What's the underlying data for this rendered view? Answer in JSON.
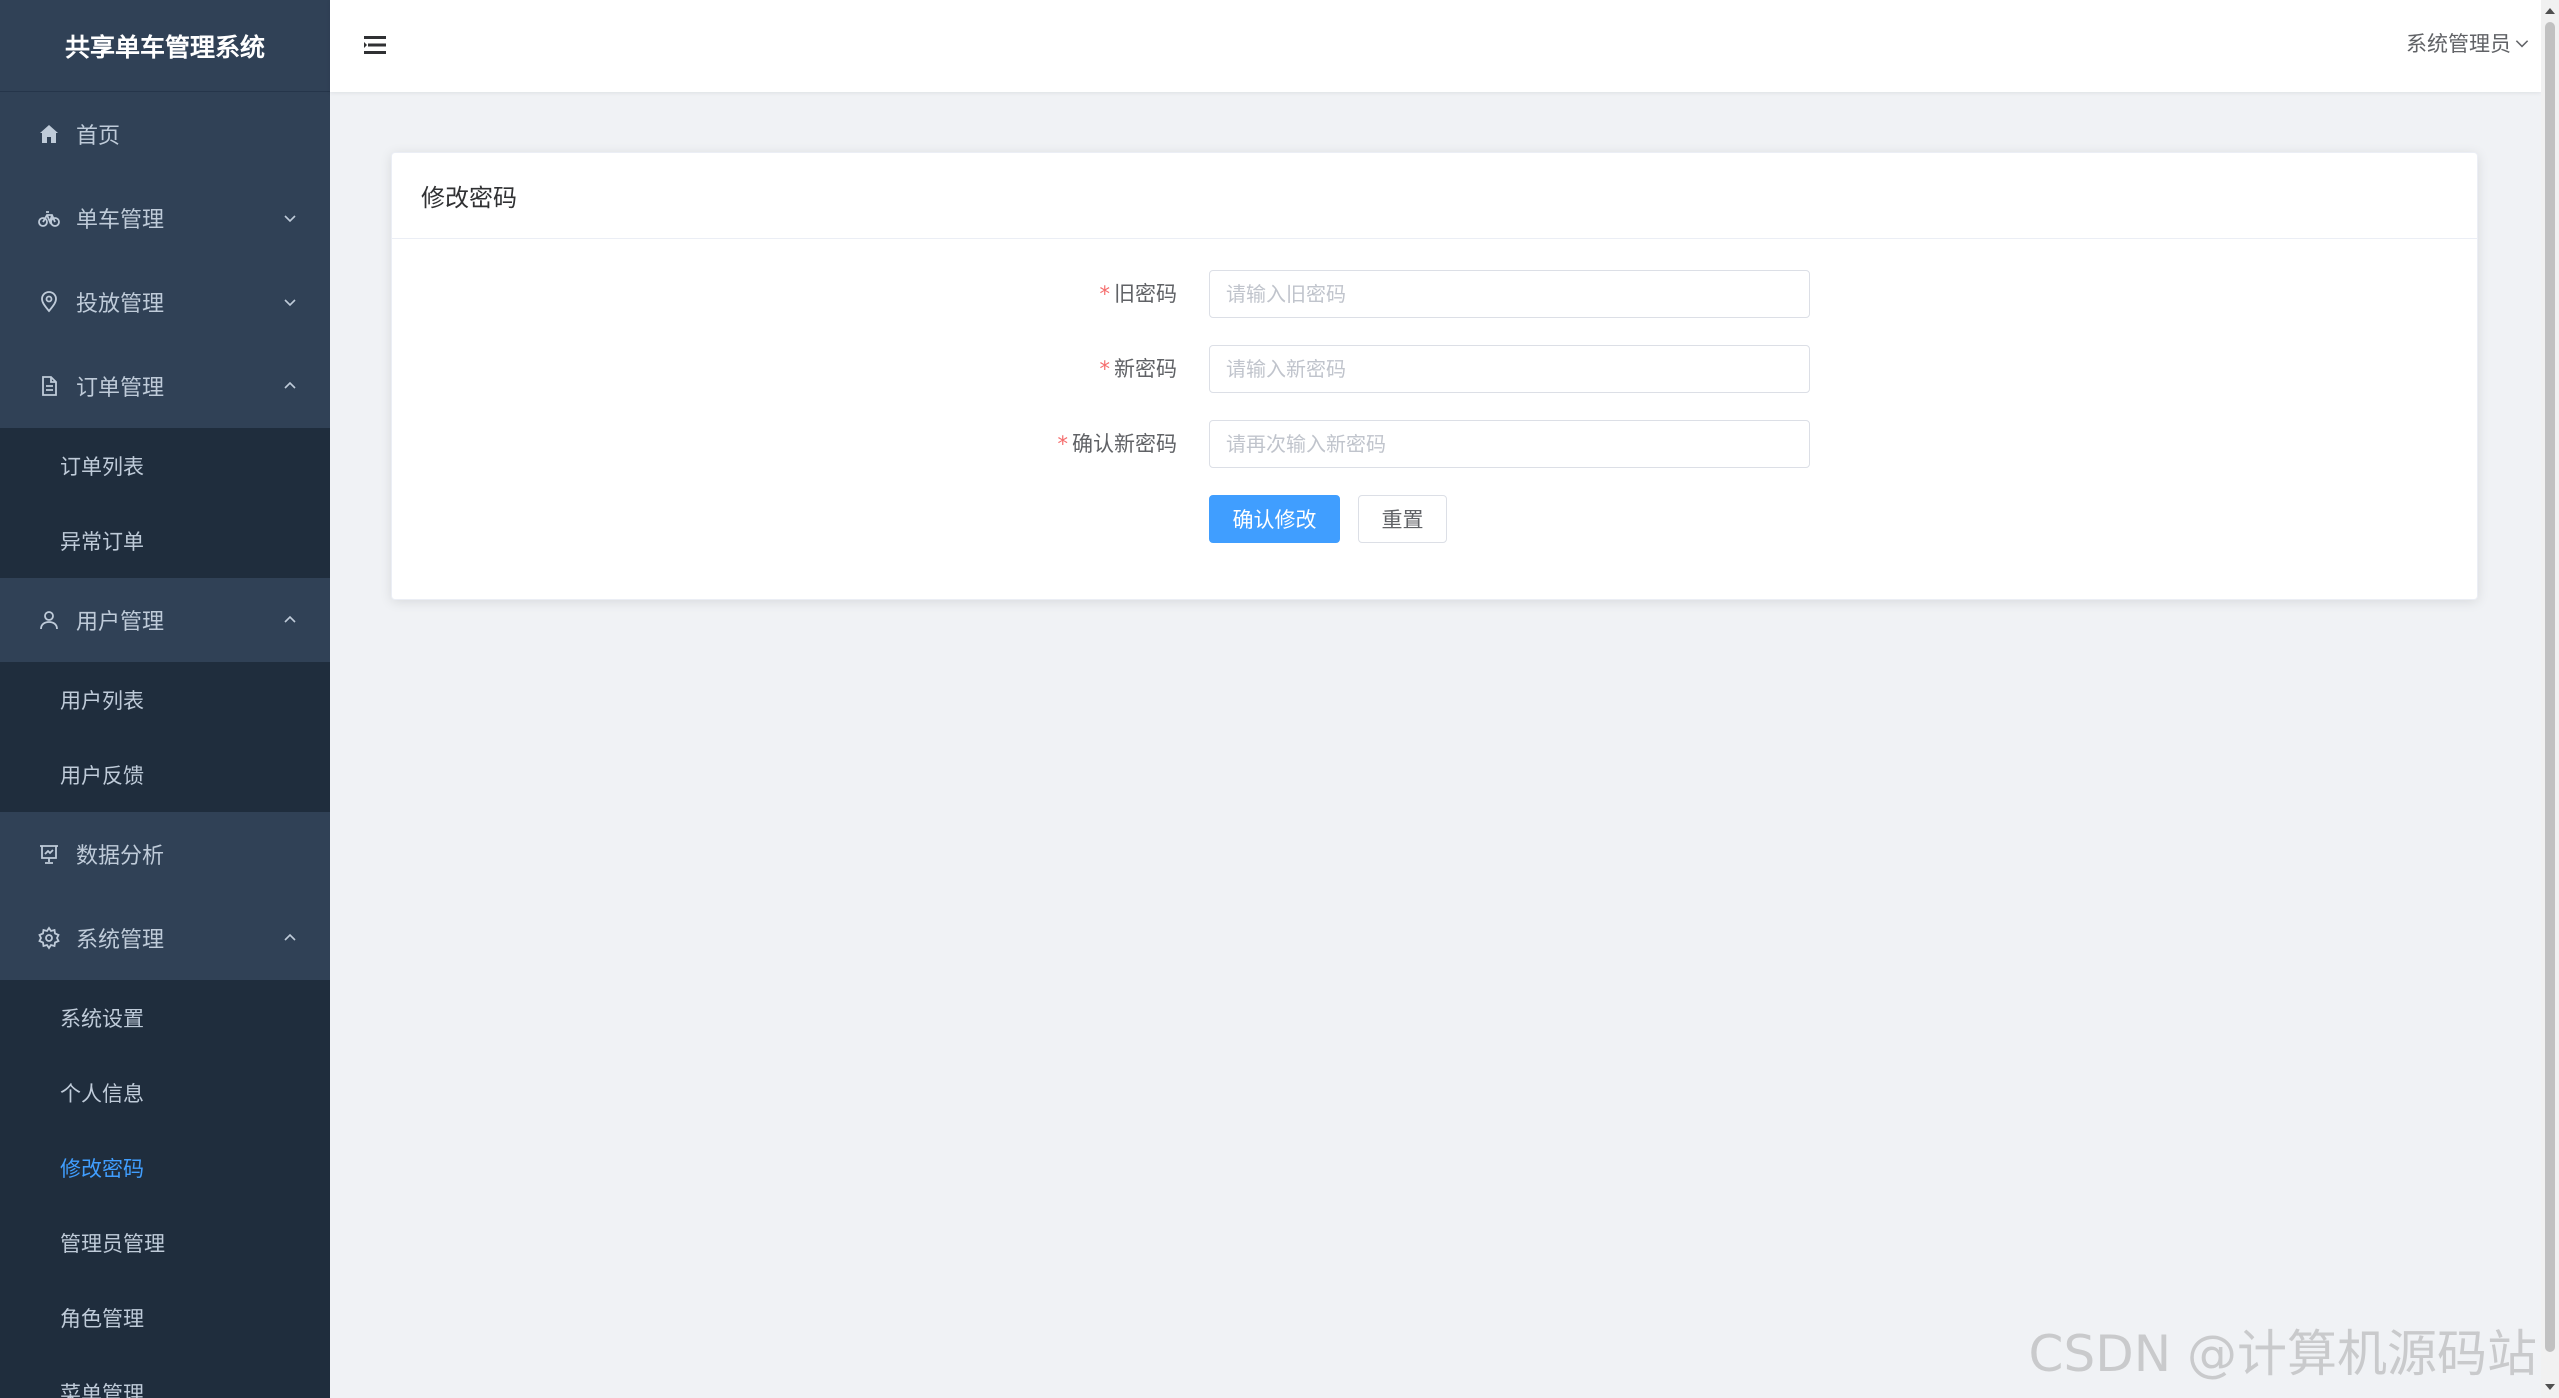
{
  "app": {
    "title": "共享单车管理系统"
  },
  "sidebar": {
    "items": [
      {
        "label": "首页",
        "icon": "home-icon",
        "expandable": false
      },
      {
        "label": "单车管理",
        "icon": "bicycle-icon",
        "expandable": true,
        "expanded": false
      },
      {
        "label": "投放管理",
        "icon": "location-icon",
        "expandable": true,
        "expanded": false
      },
      {
        "label": "订单管理",
        "icon": "document-icon",
        "expandable": true,
        "expanded": true,
        "children": [
          "订单列表",
          "异常订单"
        ]
      },
      {
        "label": "用户管理",
        "icon": "user-icon",
        "expandable": true,
        "expanded": true,
        "children": [
          "用户列表",
          "用户反馈"
        ]
      },
      {
        "label": "数据分析",
        "icon": "chart-board-icon",
        "expandable": false
      },
      {
        "label": "系统管理",
        "icon": "gear-icon",
        "expandable": true,
        "expanded": true,
        "children": [
          "系统设置",
          "个人信息",
          "修改密码",
          "管理员管理",
          "角色管理",
          "菜单管理"
        ]
      }
    ],
    "active": "修改密码"
  },
  "header": {
    "user_label": "系统管理员"
  },
  "card": {
    "title": "修改密码",
    "fields": {
      "old_password": {
        "label": "旧密码",
        "placeholder": "请输入旧密码",
        "value": ""
      },
      "new_password": {
        "label": "新密码",
        "placeholder": "请输入新密码",
        "value": ""
      },
      "confirm_password": {
        "label": "确认新密码",
        "placeholder": "请再次输入新密码",
        "value": ""
      }
    },
    "required_mark": "*",
    "confirm_label": "确认修改",
    "reset_label": "重置"
  },
  "watermark": "CSDN @计算机源码站",
  "colors": {
    "sidebar_bg": "#304156",
    "submenu_bg": "#1f2d3d",
    "menu_text": "#bfcbd9",
    "accent": "#409eff",
    "page_bg": "#f0f2f5",
    "required": "#f56c6c"
  }
}
